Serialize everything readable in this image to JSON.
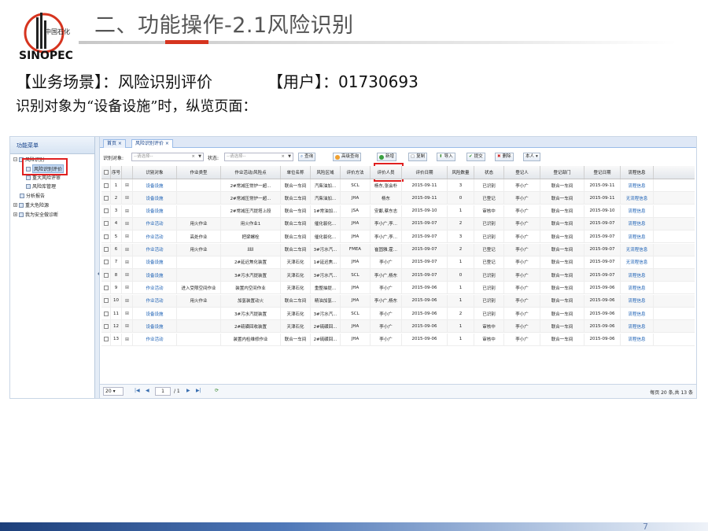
{
  "slide": {
    "title": "二、功能操作-2.1风险识别",
    "scene_label": "【业务场景】：风险识别评价",
    "user_label": "【用户】：01730693",
    "description": "识别对象为“设备设施”时，纵览页面：",
    "page_number": "7",
    "logo_text": "SINOPEC",
    "logo_cn": "中国石化",
    "accent_color": "#d6341f"
  },
  "app": {
    "left_panel_title": "功能菜单",
    "tree": [
      {
        "label": "风险识别",
        "level": 0
      },
      {
        "label": "风险识别评价",
        "level": 1,
        "selected": true
      },
      {
        "label": "重大风险评审",
        "level": 1
      },
      {
        "label": "风险库管理",
        "level": 1
      },
      {
        "label": "分析报告",
        "level": 0
      },
      {
        "label": "重大危险源",
        "level": 0
      },
      {
        "label": "我为安全做诊断",
        "level": 0
      }
    ],
    "tabs": [
      {
        "label": "首页 ×"
      },
      {
        "label": "风险识别评价 ×",
        "active": true
      }
    ],
    "filters": {
      "object_label": "识别对象:",
      "object_placeholder": "--请选择--",
      "status_label": "状态:",
      "status_placeholder": "--请选择--"
    },
    "buttons": {
      "query": "查询",
      "advanced_query": "高级查询",
      "add": "新增",
      "copy": "复制",
      "import": "导入",
      "submit": "提交",
      "delete": "删除",
      "self": "本人"
    },
    "columns": [
      "序号",
      "识别对象",
      "作业类型",
      "作业活动/风险点",
      "单位名称",
      "风险区域",
      "评价方法",
      "评价人员",
      "评价日期",
      "风险数量",
      "状态",
      "登记人",
      "登记部门",
      "登记日期",
      "流程信息"
    ],
    "rows": [
      [
        "1",
        "设备设施",
        "",
        "2#常减压常炉一超...",
        "联合一车间",
        "汽柴油加...",
        "SCL",
        "杨东,张会朴",
        "2015-09-11",
        "3",
        "已识别",
        "李小广",
        "联合一车间",
        "2015-09-11",
        "流程信息"
      ],
      [
        "2",
        "设备设施",
        "",
        "2#常减压常炉一超...",
        "联合二车间",
        "汽柴油加...",
        "JHA",
        "杨东",
        "2015-09-11",
        "0",
        "已登记",
        "李小广",
        "联合一车间",
        "2015-09-11",
        "无流程信息"
      ],
      [
        "3",
        "设备设施",
        "",
        "2#常减压汽提塔上段",
        "联合一车间",
        "1#常油加...",
        "JSA",
        "安鄱,蔡东志",
        "2015-09-10",
        "1",
        "审核中",
        "李小广",
        "联合一车间",
        "2015-09-10",
        "流程信息"
      ],
      [
        "4",
        "作业活动",
        "用火作业",
        "用火作业1",
        "联合二车间",
        "催化裂化...",
        "JHA",
        "李小广,李...",
        "2015-09-07",
        "2",
        "已识别",
        "李小广",
        "联合一车间",
        "2015-09-07",
        "流程信息"
      ],
      [
        "5",
        "作业活动",
        "高处作业",
        "把梁螺栓",
        "联合二车间",
        "催化裂化...",
        "JHA",
        "李小广,李...",
        "2015-09-07",
        "3",
        "已识别",
        "李小广",
        "联合一车间",
        "2015-09-07",
        "流程信息"
      ],
      [
        "6",
        "作业活动",
        "用火作业",
        "jjjjj",
        "联合二车间",
        "3#污水汽...",
        "FMEA",
        "崔固雅,霍...",
        "2015-09-07",
        "2",
        "已登记",
        "李小广",
        "联合一车间",
        "2015-09-07",
        "无流程信息"
      ],
      [
        "7",
        "设备设施",
        "",
        "2#延迟焦化装置",
        "天津石化",
        "1#延迟焦...",
        "JHA",
        "李小广",
        "2015-09-07",
        "1",
        "已登记",
        "李小广",
        "联合一车间",
        "2015-09-07",
        "无流程信息"
      ],
      [
        "8",
        "设备设施",
        "",
        "3#污水汽提装置",
        "天津石化",
        "3#污水汽...",
        "SCL",
        "李小广,杨东",
        "2015-09-07",
        "0",
        "已识别",
        "李小广",
        "联合一车间",
        "2015-09-07",
        "流程信息"
      ],
      [
        "9",
        "作业活动",
        "进入受限空间作业",
        "装置内空间作业",
        "天津石化",
        "重整抽提...",
        "JHA",
        "李小广",
        "2015-09-06",
        "1",
        "已识别",
        "李小广",
        "联合一车间",
        "2015-09-06",
        "流程信息"
      ],
      [
        "10",
        "作业活动",
        "用火作业",
        "加氢装置动火",
        "联合二车间",
        "精油加氢...",
        "JHA",
        "李小广,杨东",
        "2015-09-06",
        "1",
        "已识别",
        "李小广",
        "联合一车间",
        "2015-09-06",
        "流程信息"
      ],
      [
        "11",
        "设备设施",
        "",
        "3#污水汽提装置",
        "天津石化",
        "3#污水汽...",
        "SCL",
        "李小广",
        "2015-09-06",
        "2",
        "已识别",
        "李小广",
        "联合一车间",
        "2015-09-06",
        "流程信息"
      ],
      [
        "12",
        "设备设施",
        "",
        "2#硫磺回收装置",
        "天津石化",
        "2#硫磺回...",
        "JHA",
        "李小广",
        "2015-09-06",
        "1",
        "审核中",
        "李小广",
        "联合一车间",
        "2015-09-06",
        "流程信息"
      ],
      [
        "13",
        "作业活动",
        "",
        "装置内检维修作业",
        "联合一车间",
        "2#硫磺回...",
        "JHA",
        "李小广",
        "2015-09-06",
        "1",
        "审核中",
        "李小广",
        "联合一车间",
        "2015-09-06",
        "流程信息"
      ]
    ],
    "pager": {
      "page_size": "20",
      "current_page": "1",
      "total_pages": "/ 1",
      "summary": "每页 20 条,共 13 条"
    }
  }
}
